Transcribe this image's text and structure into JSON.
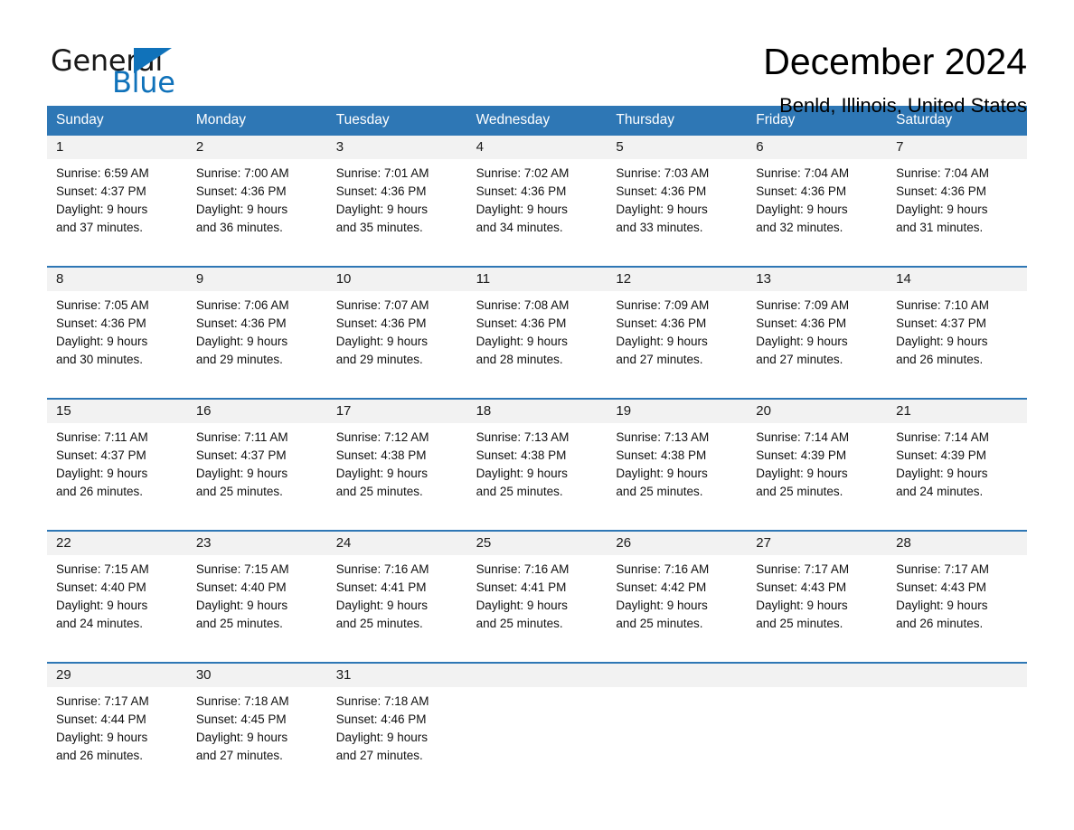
{
  "brand": {
    "name_part1": "General",
    "name_part2": "Blue",
    "accent_color": "#1072BA"
  },
  "header": {
    "title": "December 2024",
    "subtitle": "Benld, Illinois, United States",
    "header_color": "#2E77B5"
  },
  "weekdays": [
    "Sunday",
    "Monday",
    "Tuesday",
    "Wednesday",
    "Thursday",
    "Friday",
    "Saturday"
  ],
  "weeks": [
    {
      "days": [
        {
          "date": "1",
          "sunrise": "Sunrise: 6:59 AM",
          "sunset": "Sunset: 4:37 PM",
          "daylight_1": "Daylight: 9 hours",
          "daylight_2": "and 37 minutes."
        },
        {
          "date": "2",
          "sunrise": "Sunrise: 7:00 AM",
          "sunset": "Sunset: 4:36 PM",
          "daylight_1": "Daylight: 9 hours",
          "daylight_2": "and 36 minutes."
        },
        {
          "date": "3",
          "sunrise": "Sunrise: 7:01 AM",
          "sunset": "Sunset: 4:36 PM",
          "daylight_1": "Daylight: 9 hours",
          "daylight_2": "and 35 minutes."
        },
        {
          "date": "4",
          "sunrise": "Sunrise: 7:02 AM",
          "sunset": "Sunset: 4:36 PM",
          "daylight_1": "Daylight: 9 hours",
          "daylight_2": "and 34 minutes."
        },
        {
          "date": "5",
          "sunrise": "Sunrise: 7:03 AM",
          "sunset": "Sunset: 4:36 PM",
          "daylight_1": "Daylight: 9 hours",
          "daylight_2": "and 33 minutes."
        },
        {
          "date": "6",
          "sunrise": "Sunrise: 7:04 AM",
          "sunset": "Sunset: 4:36 PM",
          "daylight_1": "Daylight: 9 hours",
          "daylight_2": "and 32 minutes."
        },
        {
          "date": "7",
          "sunrise": "Sunrise: 7:04 AM",
          "sunset": "Sunset: 4:36 PM",
          "daylight_1": "Daylight: 9 hours",
          "daylight_2": "and 31 minutes."
        }
      ]
    },
    {
      "days": [
        {
          "date": "8",
          "sunrise": "Sunrise: 7:05 AM",
          "sunset": "Sunset: 4:36 PM",
          "daylight_1": "Daylight: 9 hours",
          "daylight_2": "and 30 minutes."
        },
        {
          "date": "9",
          "sunrise": "Sunrise: 7:06 AM",
          "sunset": "Sunset: 4:36 PM",
          "daylight_1": "Daylight: 9 hours",
          "daylight_2": "and 29 minutes."
        },
        {
          "date": "10",
          "sunrise": "Sunrise: 7:07 AM",
          "sunset": "Sunset: 4:36 PM",
          "daylight_1": "Daylight: 9 hours",
          "daylight_2": "and 29 minutes."
        },
        {
          "date": "11",
          "sunrise": "Sunrise: 7:08 AM",
          "sunset": "Sunset: 4:36 PM",
          "daylight_1": "Daylight: 9 hours",
          "daylight_2": "and 28 minutes."
        },
        {
          "date": "12",
          "sunrise": "Sunrise: 7:09 AM",
          "sunset": "Sunset: 4:36 PM",
          "daylight_1": "Daylight: 9 hours",
          "daylight_2": "and 27 minutes."
        },
        {
          "date": "13",
          "sunrise": "Sunrise: 7:09 AM",
          "sunset": "Sunset: 4:36 PM",
          "daylight_1": "Daylight: 9 hours",
          "daylight_2": "and 27 minutes."
        },
        {
          "date": "14",
          "sunrise": "Sunrise: 7:10 AM",
          "sunset": "Sunset: 4:37 PM",
          "daylight_1": "Daylight: 9 hours",
          "daylight_2": "and 26 minutes."
        }
      ]
    },
    {
      "days": [
        {
          "date": "15",
          "sunrise": "Sunrise: 7:11 AM",
          "sunset": "Sunset: 4:37 PM",
          "daylight_1": "Daylight: 9 hours",
          "daylight_2": "and 26 minutes."
        },
        {
          "date": "16",
          "sunrise": "Sunrise: 7:11 AM",
          "sunset": "Sunset: 4:37 PM",
          "daylight_1": "Daylight: 9 hours",
          "daylight_2": "and 25 minutes."
        },
        {
          "date": "17",
          "sunrise": "Sunrise: 7:12 AM",
          "sunset": "Sunset: 4:38 PM",
          "daylight_1": "Daylight: 9 hours",
          "daylight_2": "and 25 minutes."
        },
        {
          "date": "18",
          "sunrise": "Sunrise: 7:13 AM",
          "sunset": "Sunset: 4:38 PM",
          "daylight_1": "Daylight: 9 hours",
          "daylight_2": "and 25 minutes."
        },
        {
          "date": "19",
          "sunrise": "Sunrise: 7:13 AM",
          "sunset": "Sunset: 4:38 PM",
          "daylight_1": "Daylight: 9 hours",
          "daylight_2": "and 25 minutes."
        },
        {
          "date": "20",
          "sunrise": "Sunrise: 7:14 AM",
          "sunset": "Sunset: 4:39 PM",
          "daylight_1": "Daylight: 9 hours",
          "daylight_2": "and 25 minutes."
        },
        {
          "date": "21",
          "sunrise": "Sunrise: 7:14 AM",
          "sunset": "Sunset: 4:39 PM",
          "daylight_1": "Daylight: 9 hours",
          "daylight_2": "and 24 minutes."
        }
      ]
    },
    {
      "days": [
        {
          "date": "22",
          "sunrise": "Sunrise: 7:15 AM",
          "sunset": "Sunset: 4:40 PM",
          "daylight_1": "Daylight: 9 hours",
          "daylight_2": "and 24 minutes."
        },
        {
          "date": "23",
          "sunrise": "Sunrise: 7:15 AM",
          "sunset": "Sunset: 4:40 PM",
          "daylight_1": "Daylight: 9 hours",
          "daylight_2": "and 25 minutes."
        },
        {
          "date": "24",
          "sunrise": "Sunrise: 7:16 AM",
          "sunset": "Sunset: 4:41 PM",
          "daylight_1": "Daylight: 9 hours",
          "daylight_2": "and 25 minutes."
        },
        {
          "date": "25",
          "sunrise": "Sunrise: 7:16 AM",
          "sunset": "Sunset: 4:41 PM",
          "daylight_1": "Daylight: 9 hours",
          "daylight_2": "and 25 minutes."
        },
        {
          "date": "26",
          "sunrise": "Sunrise: 7:16 AM",
          "sunset": "Sunset: 4:42 PM",
          "daylight_1": "Daylight: 9 hours",
          "daylight_2": "and 25 minutes."
        },
        {
          "date": "27",
          "sunrise": "Sunrise: 7:17 AM",
          "sunset": "Sunset: 4:43 PM",
          "daylight_1": "Daylight: 9 hours",
          "daylight_2": "and 25 minutes."
        },
        {
          "date": "28",
          "sunrise": "Sunrise: 7:17 AM",
          "sunset": "Sunset: 4:43 PM",
          "daylight_1": "Daylight: 9 hours",
          "daylight_2": "and 26 minutes."
        }
      ]
    },
    {
      "days": [
        {
          "date": "29",
          "sunrise": "Sunrise: 7:17 AM",
          "sunset": "Sunset: 4:44 PM",
          "daylight_1": "Daylight: 9 hours",
          "daylight_2": "and 26 minutes."
        },
        {
          "date": "30",
          "sunrise": "Sunrise: 7:18 AM",
          "sunset": "Sunset: 4:45 PM",
          "daylight_1": "Daylight: 9 hours",
          "daylight_2": "and 27 minutes."
        },
        {
          "date": "31",
          "sunrise": "Sunrise: 7:18 AM",
          "sunset": "Sunset: 4:46 PM",
          "daylight_1": "Daylight: 9 hours",
          "daylight_2": "and 27 minutes."
        },
        {
          "date": "",
          "sunrise": "",
          "sunset": "",
          "daylight_1": "",
          "daylight_2": ""
        },
        {
          "date": "",
          "sunrise": "",
          "sunset": "",
          "daylight_1": "",
          "daylight_2": ""
        },
        {
          "date": "",
          "sunrise": "",
          "sunset": "",
          "daylight_1": "",
          "daylight_2": ""
        },
        {
          "date": "",
          "sunrise": "",
          "sunset": "",
          "daylight_1": "",
          "daylight_2": ""
        }
      ]
    }
  ]
}
